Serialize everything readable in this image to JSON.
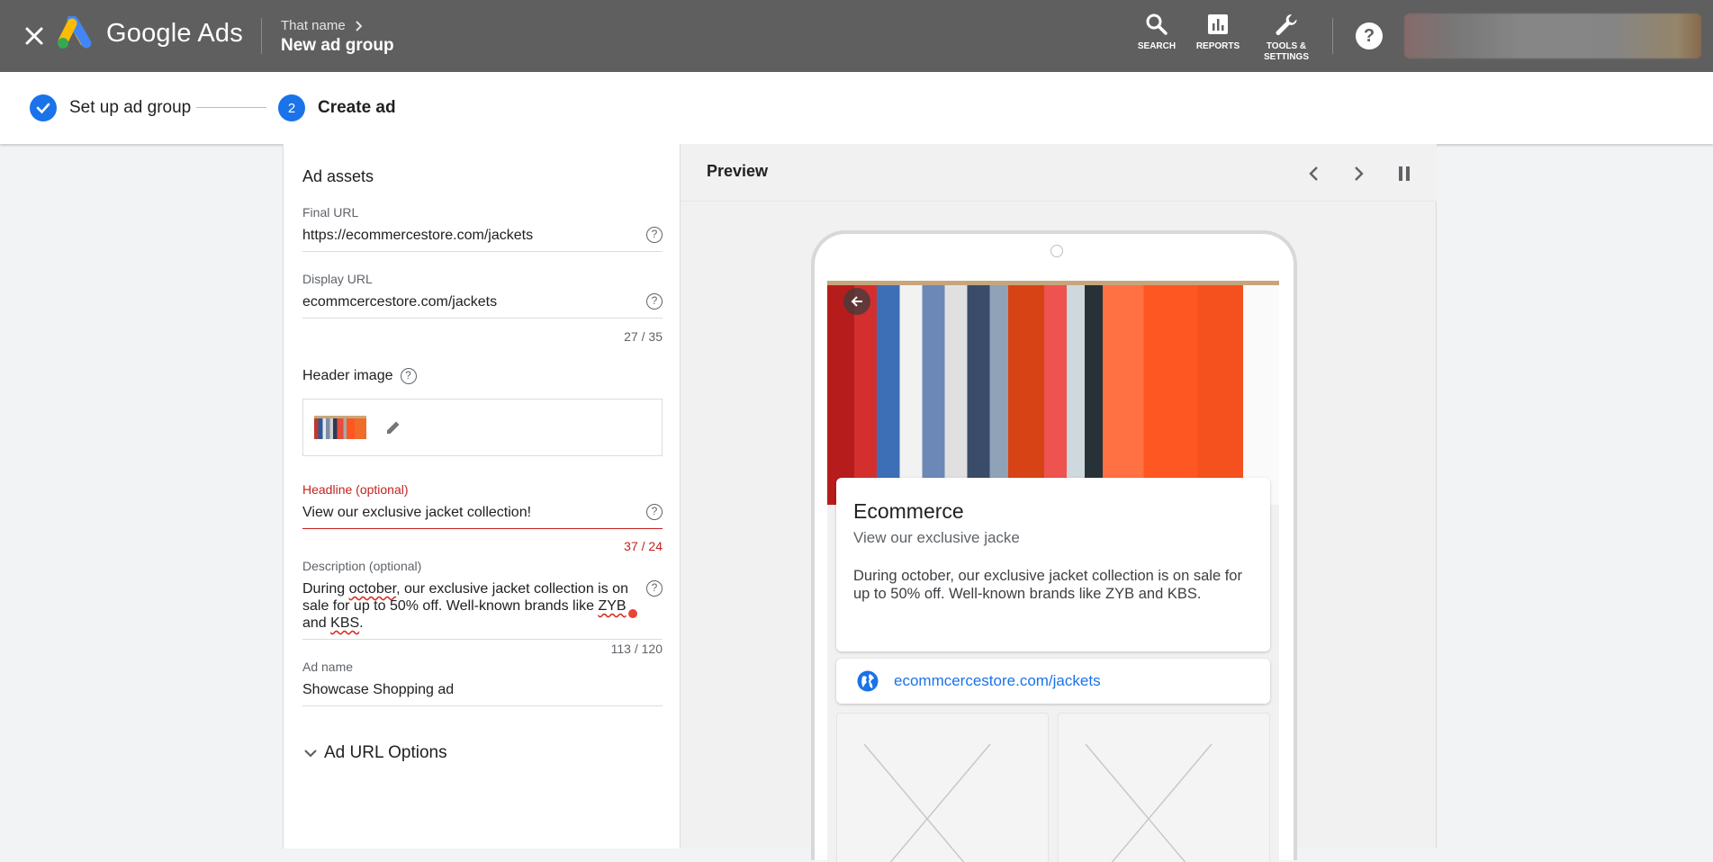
{
  "topbar": {
    "brand": "Google Ads",
    "breadcrumb_parent": "That name",
    "breadcrumb_current": "New ad group",
    "actions": {
      "search": "SEARCH",
      "reports": "REPORTS",
      "tools_line1": "TOOLS &",
      "tools_line2": "SETTINGS"
    },
    "help": "?"
  },
  "stepper": {
    "step1_label": "Set up ad group",
    "step2_number": "2",
    "step2_label": "Create ad"
  },
  "form": {
    "section_title": "Ad assets",
    "final_url": {
      "label": "Final URL",
      "value": "https://ecommercestore.com/jackets"
    },
    "display_url": {
      "label": "Display URL",
      "value": "ecommcercestore.com/jackets",
      "counter": "27 / 35"
    },
    "header_image": {
      "label": "Header image"
    },
    "headline": {
      "label": "Headline (optional)",
      "value": "View our exclusive jacket collection!",
      "counter": "37 / 24"
    },
    "description": {
      "label": "Description (optional)",
      "value_part1": "During ",
      "value_misspelled1": "october",
      "value_part2": ", our exclusive jacket collection is on sale for up to 50% off. Well-known brands like ",
      "value_misspelled2": "ZYB",
      "value_part3": " and ",
      "value_misspelled3": "KBS",
      "value_part4": ".",
      "counter": "113 / 120"
    },
    "ad_name": {
      "label": "Ad name",
      "value": "Showcase Shopping ad"
    },
    "url_options": "Ad URL Options"
  },
  "preview": {
    "title": "Preview",
    "card_headline": "Ecommerce",
    "card_subheadline": "View our exclusive jacke",
    "card_description": "During october, our exclusive jacket collection is on sale for up to 50% off. Well-known brands like ZYB and KBS.",
    "card_url": "ecommcercestore.com/jackets"
  },
  "icons": {
    "close": "close-icon",
    "search": "search-icon",
    "reports": "bar-chart-icon",
    "tools": "wrench-icon",
    "help": "help-icon",
    "check": "check-icon",
    "edit": "pencil-icon",
    "globe": "globe-icon",
    "prev": "chevron-left-icon",
    "next": "chevron-right-icon",
    "pause": "pause-icon",
    "back": "arrow-back-icon",
    "expand": "chevron-down-icon"
  },
  "colors": {
    "topbar": "#5f5f5f",
    "accent": "#1a73e8",
    "error": "#c5221f"
  }
}
